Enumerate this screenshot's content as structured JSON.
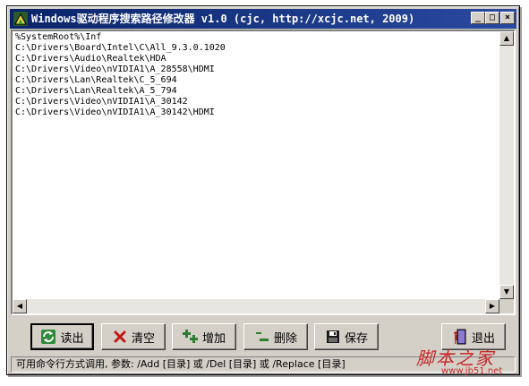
{
  "window": {
    "title": "Windows驱动程序搜索路径修改器 v1.0 (cjc, http://xcjc.net, 2009)",
    "caption_buttons": {
      "minimize": "_",
      "maximize": "□",
      "close": "×"
    }
  },
  "editor": {
    "lines": "%SystemRoot%\\Inf\nC:\\Drivers\\Board\\Intel\\C\\All_9.3.0.1020\nC:\\Drivers\\Audio\\Realtek\\HDA\nC:\\Drivers\\Video\\nVIDIA1\\A_28558\\HDMI\nC:\\Drivers\\Lan\\Realtek\\C_5_694\nC:\\Drivers\\Lan\\Realtek\\A_5_794\nC:\\Drivers\\Video\\nVIDIA1\\A_30142\nC:\\Drivers\\Video\\nVIDIA1\\A_30142\\HDMI"
  },
  "toolbar": {
    "read_label": "读出",
    "clear_label": "清空",
    "add_label": "增加",
    "delete_label": "删除",
    "save_label": "保存",
    "exit_label": "退出"
  },
  "icons": {
    "read": "refresh-icon",
    "clear": "red-x-icon",
    "add": "plus-icon",
    "delete": "minus-icon",
    "save": "floppy-disk-icon",
    "exit": "exit-door-icon"
  },
  "statusbar": {
    "text": "可用命令行方式调用, 参数: /Add [目录] 或 /Del [目录] 或 /Replace [目录]"
  },
  "watermark": {
    "text": "脚本之家",
    "url": "www.jb51.net"
  },
  "colors": {
    "title_bar": "#0a246a",
    "face": "#d4d0c8",
    "watermark": "#c8282a"
  }
}
